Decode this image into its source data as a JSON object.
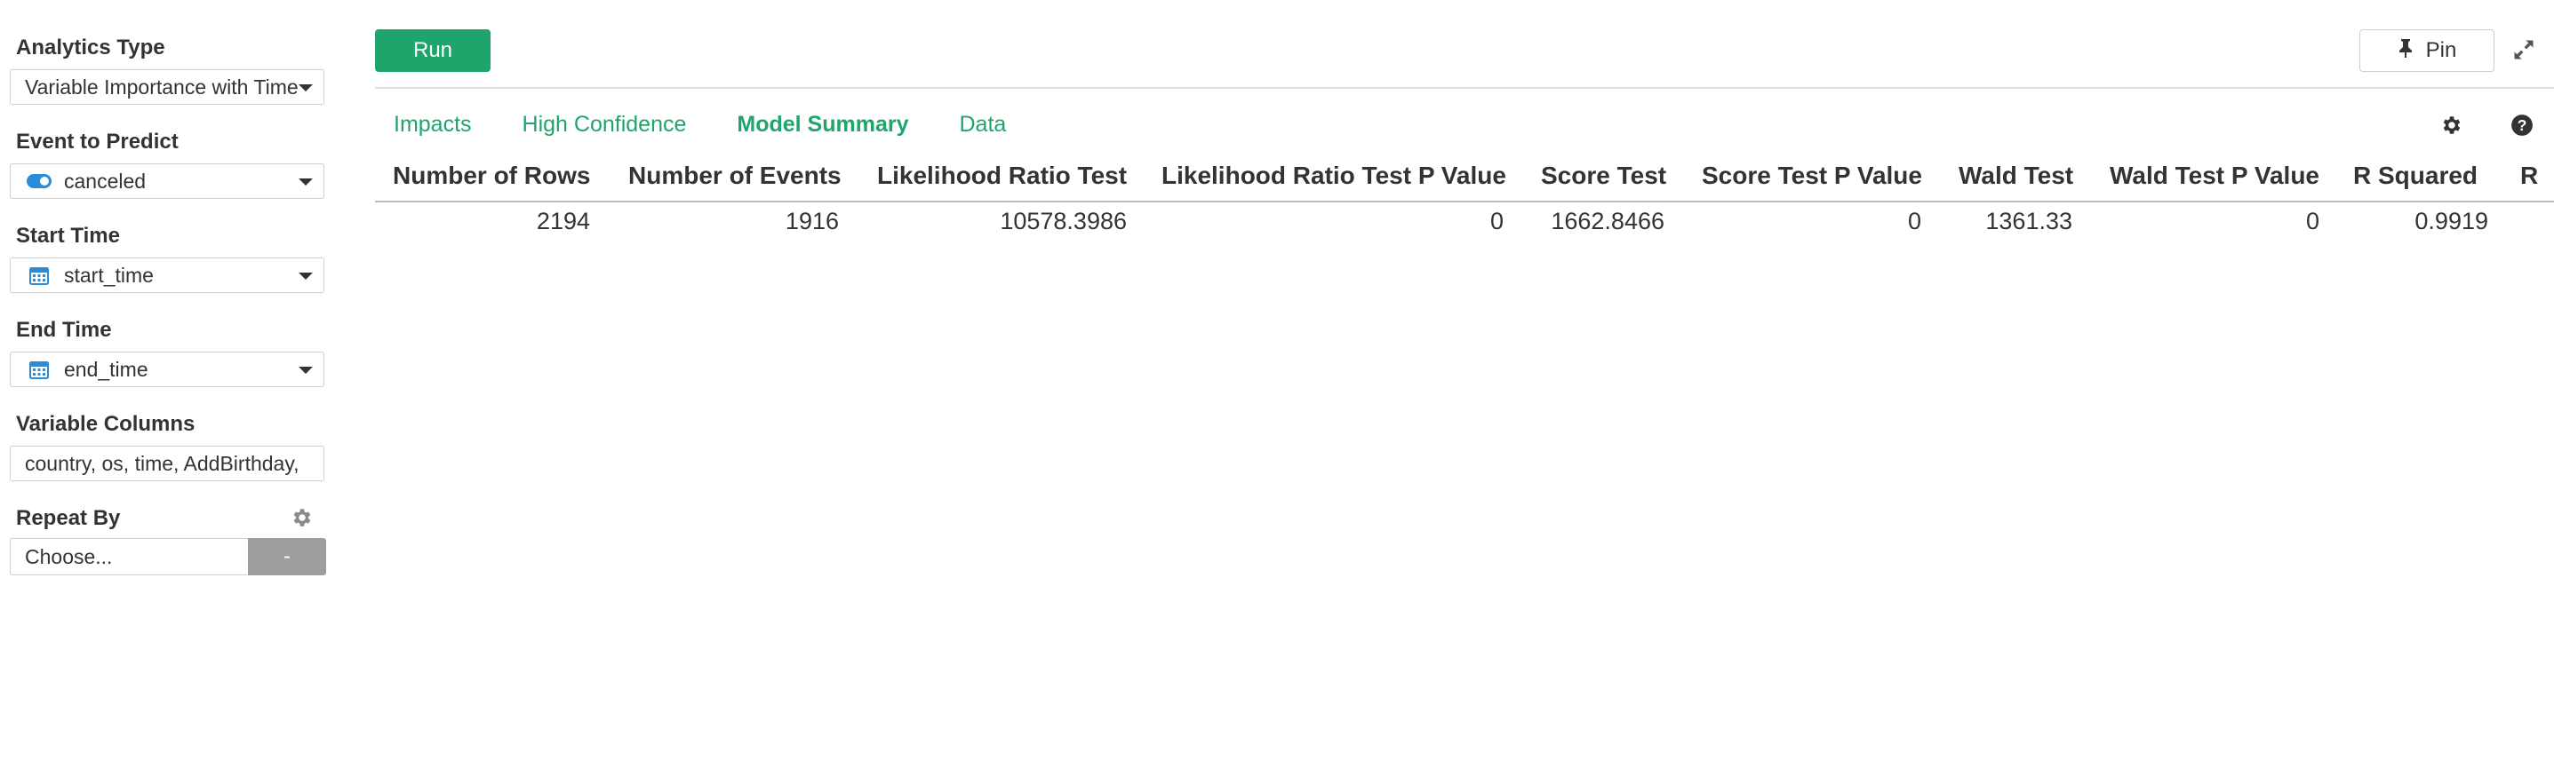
{
  "sidebar": {
    "analytics_type": {
      "label": "Analytics Type",
      "value": "Variable Importance with Time"
    },
    "event_to_predict": {
      "label": "Event to Predict",
      "value": "canceled"
    },
    "start_time": {
      "label": "Start Time",
      "value": "start_time"
    },
    "end_time": {
      "label": "End Time",
      "value": "end_time"
    },
    "variable_columns": {
      "label": "Variable Columns",
      "value": "country, os, time, AddBirthday, "
    },
    "repeat_by": {
      "label": "Repeat By",
      "placeholder": "Choose...",
      "button": "-"
    }
  },
  "toolbar": {
    "run_label": "Run",
    "pin_label": "Pin"
  },
  "tabs": [
    {
      "label": "Impacts"
    },
    {
      "label": "High Confidence"
    },
    {
      "label": "Model Summary"
    },
    {
      "label": "Data"
    }
  ],
  "table": {
    "headers": [
      "Number of Rows",
      "Number of Events",
      "Likelihood Ratio Test",
      "Likelihood Ratio Test P Value",
      "Score Test",
      "Score Test P Value",
      "Wald Test",
      "Wald Test P Value",
      "R Squared",
      "R"
    ],
    "row": [
      "2194",
      "1916",
      "10578.3986",
      "0",
      "1662.8466",
      "0",
      "1361.33",
      "0",
      "0.9919",
      ""
    ]
  },
  "colors": {
    "accent": "#1fa56b",
    "toggle": "#2e8bd6",
    "calendar": "#2e8bd6",
    "repeat_button": "#9e9e9e"
  },
  "icons": [
    "toggle-icon",
    "calendar-icon",
    "gear-icon",
    "pin-icon",
    "expand-icon",
    "help-icon",
    "chevron-down-icon"
  ]
}
